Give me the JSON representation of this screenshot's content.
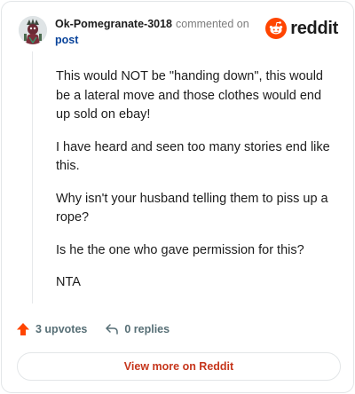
{
  "comment": {
    "username": "Ok-Pomegranate-3018",
    "action": "commented on",
    "post_link": "post"
  },
  "brand": {
    "name": "reddit",
    "icon": "reddit-alien-icon",
    "accent": "#ff4500"
  },
  "body": {
    "paragraphs": [
      "This would NOT be \"handing down\", this would be a lateral move and those clothes would end up sold on ebay!",
      "I have heard and seen too many stories end like this.",
      "Why isn't your husband telling them to piss up a rope?",
      "Is he the one who gave permission for this?",
      "NTA"
    ]
  },
  "stats": {
    "upvotes": "3 upvotes",
    "replies": "0 replies",
    "upvote_icon": "upvote-arrow-icon",
    "reply_icon": "reply-arrow-icon"
  },
  "cta": {
    "label": "View more on Reddit",
    "color": "#c6361c"
  }
}
